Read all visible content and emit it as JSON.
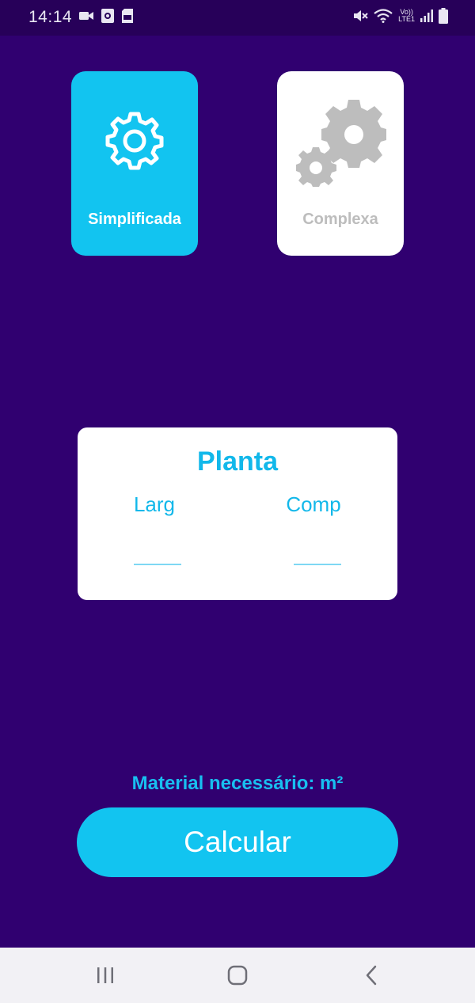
{
  "status_bar": {
    "time": "14:14",
    "left_icons": [
      "video-camera-icon",
      "screen-record-icon",
      "sd-card-icon"
    ],
    "right_icons": [
      "mute-icon",
      "wifi-icon",
      "volte-lte-icon",
      "signal-icon",
      "battery-icon"
    ],
    "network_label_top": "Vo))",
    "network_label_bottom": "LTE1"
  },
  "modes": [
    {
      "label": "Simplificada",
      "icon": "gear-icon",
      "selected": true
    },
    {
      "label": "Complexa",
      "icon": "gears-icon",
      "selected": false
    }
  ],
  "planta": {
    "title": "Planta",
    "width_label": "Larg",
    "length_label": "Comp",
    "width_value": "",
    "length_value": ""
  },
  "result": {
    "text": "Material necessário: m²"
  },
  "action": {
    "label": "Calcular"
  },
  "navigation": {
    "buttons": [
      "recent-apps-icon",
      "home-icon",
      "back-icon"
    ]
  },
  "colors": {
    "background": "#300070",
    "accent": "#12c4f0",
    "inactive": "#bdbdbd"
  }
}
